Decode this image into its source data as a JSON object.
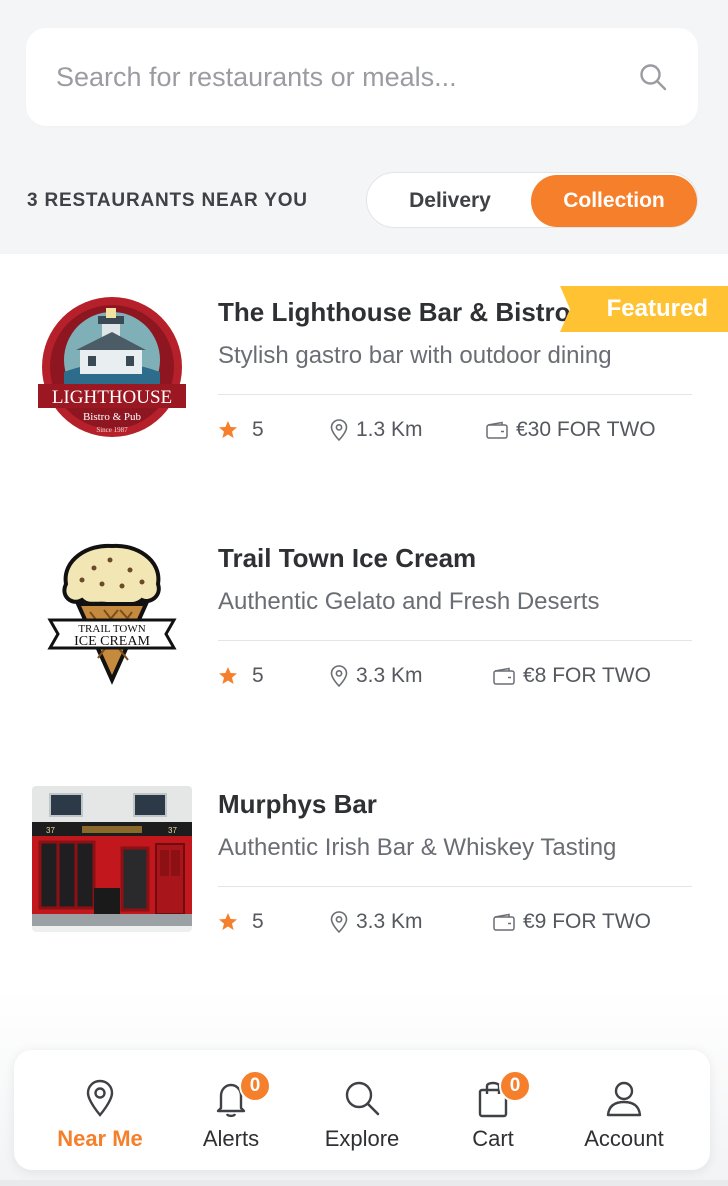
{
  "search": {
    "placeholder": "Search for restaurants or meals...",
    "icon": "search-icon"
  },
  "header": {
    "count_label": "3 RESTAURANTS NEAR YOU"
  },
  "mode_toggle": {
    "options": [
      "Delivery",
      "Collection"
    ],
    "selected": "Collection"
  },
  "colors": {
    "accent": "#f57f2b",
    "featured": "#ffc233",
    "star": "#f57f2b"
  },
  "restaurants": [
    {
      "name": "The Lighthouse Bar & Bistro",
      "description": "Stylish gastro bar with outdoor dining",
      "rating": "5",
      "distance": "1.3 Km",
      "price": "€30 FOR TWO",
      "badge": "Featured",
      "logo": {
        "title": "LIGHTHOUSE",
        "subtitle": "Bistro & Pub",
        "since": "Since 1987"
      }
    },
    {
      "name": "Trail Town Ice Cream",
      "description": "Authentic Gelato and Fresh Deserts",
      "rating": "5",
      "distance": "3.3 Km",
      "price": "€8 FOR TWO",
      "logo": {
        "line1": "TRAIL TOWN",
        "line2": "ICE CREAM"
      }
    },
    {
      "name": "Murphys Bar",
      "description": "Authentic Irish Bar & Whiskey Tasting",
      "rating": "5",
      "distance": "3.3 Km",
      "price": "€9 FOR TWO",
      "logo": {
        "number": "37"
      }
    }
  ],
  "nav": {
    "items": [
      {
        "label": "Near Me",
        "icon": "location-pin-icon",
        "active": true
      },
      {
        "label": "Alerts",
        "icon": "bell-icon",
        "badge": "0"
      },
      {
        "label": "Explore",
        "icon": "search-icon"
      },
      {
        "label": "Cart",
        "icon": "shopping-bag-icon",
        "badge": "0"
      },
      {
        "label": "Account",
        "icon": "user-icon"
      }
    ]
  }
}
